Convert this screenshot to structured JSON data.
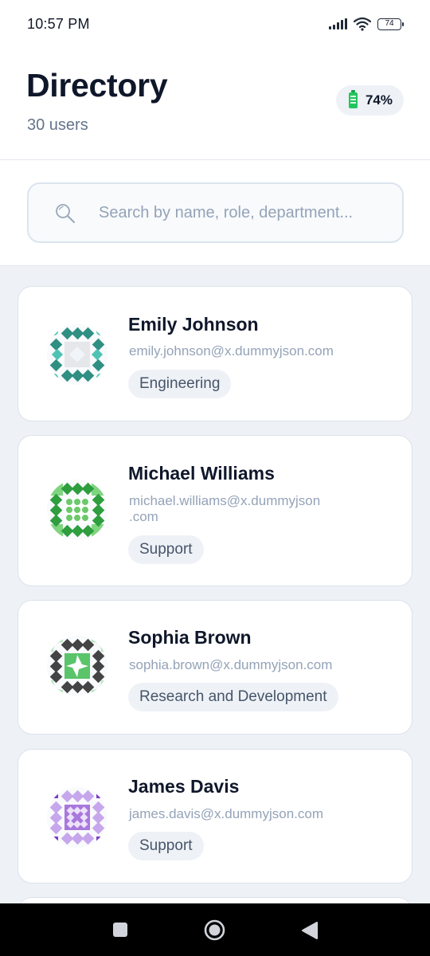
{
  "status_bar": {
    "time": "10:57 PM",
    "battery_level": "74"
  },
  "header": {
    "title": "Directory",
    "subtitle": "30 users",
    "battery_badge": "74%"
  },
  "search": {
    "placeholder": "Search by name, role, department...",
    "value": ""
  },
  "users": [
    {
      "name": "Emily Johnson",
      "email": "emily.johnson@x.dummyjson.com",
      "department": "Engineering",
      "avatar_colors": [
        "#2f8f83",
        "#4fc3b3",
        "#e5e7eb"
      ]
    },
    {
      "name": "Michael Williams",
      "email": "michael.williams@x.dummyjson\n.com",
      "department": "Support",
      "avatar_colors": [
        "#2e9e3e",
        "#7fd47f",
        "#d9f0d9"
      ]
    },
    {
      "name": "Sophia Brown",
      "email": "sophia.brown@x.dummyjson.com",
      "department": "Research and Development",
      "avatar_colors": [
        "#444444",
        "#5ac46a",
        "#b7e4bf"
      ]
    },
    {
      "name": "James Davis",
      "email": "james.davis@x.dummyjson.com",
      "department": "Support",
      "avatar_colors": [
        "#7b3fc4",
        "#c7a7ec",
        "#a978dd"
      ]
    }
  ],
  "icons": {
    "search": "search-icon",
    "battery": "battery-icon",
    "home": "home-icon",
    "back": "back-icon",
    "recents": "recents-icon"
  }
}
